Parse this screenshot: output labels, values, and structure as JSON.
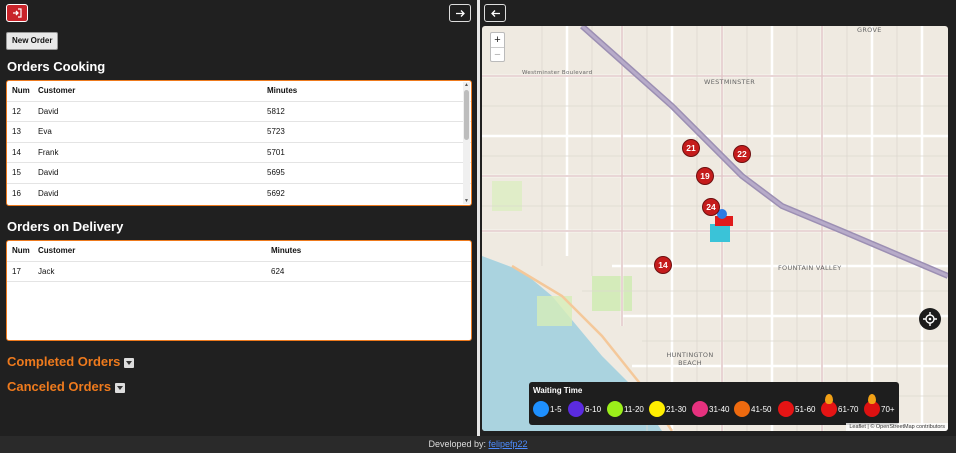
{
  "left_panel": {
    "new_order_label": "New Order",
    "cooking": {
      "title": "Orders Cooking",
      "columns": [
        "Num",
        "Customer",
        "Minutes"
      ],
      "rows": [
        {
          "num": "12",
          "customer": "David",
          "minutes": "5812"
        },
        {
          "num": "13",
          "customer": "Eva",
          "minutes": "5723"
        },
        {
          "num": "14",
          "customer": "Frank",
          "minutes": "5701"
        },
        {
          "num": "15",
          "customer": "David",
          "minutes": "5695"
        },
        {
          "num": "16",
          "customer": "David",
          "minutes": "5692"
        }
      ]
    },
    "delivery": {
      "title": "Orders on Delivery",
      "columns": [
        "Num",
        "Customer",
        "Minutes"
      ],
      "rows": [
        {
          "num": "17",
          "customer": "Jack",
          "minutes": "624"
        }
      ]
    },
    "completed_title": "Completed Orders",
    "canceled_title": "Canceled Orders"
  },
  "map": {
    "zoom_in": "+",
    "zoom_out": "−",
    "labels": {
      "grove": "GROVE",
      "westminster": "WESTMINSTER",
      "westminster_blvd": "Westminster Boulevard",
      "fountain_valley": "FOUNTAIN VALLEY",
      "huntington_beach": "HUNTINGTON BEACH"
    },
    "markers": [
      {
        "label": "21"
      },
      {
        "label": "22"
      },
      {
        "label": "19"
      },
      {
        "label": "24"
      },
      {
        "label": "14"
      }
    ],
    "attribution": "Leaflet | © OpenStreetMap contributors",
    "legend": {
      "title": "Waiting Time",
      "items": [
        {
          "label": "1-5",
          "color": "#1e90ff"
        },
        {
          "label": "6-10",
          "color": "#5b2be0"
        },
        {
          "label": "11-20",
          "color": "#9bee1a"
        },
        {
          "label": "21-30",
          "color": "#ffee00"
        },
        {
          "label": "31-40",
          "color": "#e6317e"
        },
        {
          "label": "41-50",
          "color": "#ee6a0f"
        },
        {
          "label": "51-60",
          "color": "#e51414"
        },
        {
          "label": "61-70",
          "color": "#e51414"
        },
        {
          "label": "70+",
          "color": "#d11"
        }
      ]
    }
  },
  "footer": {
    "text": "Developed by: ",
    "link": "felipefp22"
  },
  "colors": {
    "accent": "#ee7a1d",
    "logout": "#c8242a"
  }
}
